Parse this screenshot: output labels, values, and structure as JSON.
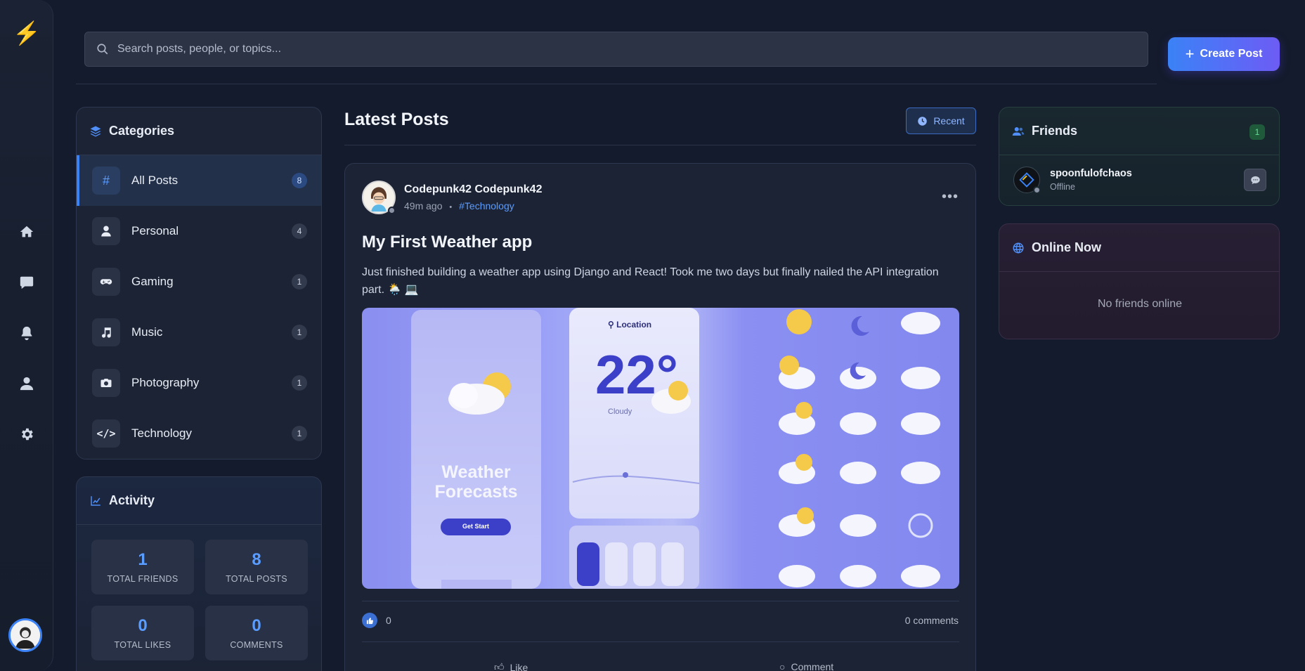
{
  "app": {
    "logo_icon": "lightning-bolt-icon"
  },
  "rail": {
    "items": [
      {
        "icon": "home-icon"
      },
      {
        "icon": "chat-icon"
      },
      {
        "icon": "bell-icon"
      },
      {
        "icon": "user-icon"
      },
      {
        "icon": "gear-icon"
      }
    ]
  },
  "search": {
    "placeholder": "Search posts, people, or topics..."
  },
  "header": {
    "create_label": "Create Post"
  },
  "categories": {
    "title": "Categories",
    "items": [
      {
        "label": "All Posts",
        "count": "8",
        "icon": "hash-icon",
        "active": true
      },
      {
        "label": "Personal",
        "count": "4",
        "icon": "person-icon"
      },
      {
        "label": "Gaming",
        "count": "1",
        "icon": "gamepad-icon"
      },
      {
        "label": "Music",
        "count": "1",
        "icon": "music-note-icon"
      },
      {
        "label": "Photography",
        "count": "1",
        "icon": "camera-icon"
      },
      {
        "label": "Technology",
        "count": "1",
        "icon": "code-icon"
      }
    ]
  },
  "activity": {
    "title": "Activity",
    "stats": [
      {
        "value": "1",
        "label": "TOTAL FRIENDS"
      },
      {
        "value": "8",
        "label": "TOTAL POSTS"
      },
      {
        "value": "0",
        "label": "TOTAL LIKES"
      },
      {
        "value": "0",
        "label": "COMMENTS"
      }
    ]
  },
  "feed": {
    "title": "Latest Posts",
    "sort_label": "Recent",
    "post": {
      "author": "Codepunk42 Codepunk42",
      "time": "49m ago",
      "separator": "•",
      "tag": "#Technology",
      "title": "My First Weather app",
      "body": "Just finished building a weather app using Django and React! Took me two days but finally nailed the API integration part. 🌦️ 💻",
      "image": {
        "heading_line1": "Weather",
        "heading_line2": "Forecasts",
        "button": "Get Start",
        "location": "Location",
        "temp": "22°",
        "condition": "Cloudy"
      },
      "like_count": "0",
      "comment_count": "0 comments",
      "like_label": "Like",
      "comment_label": "Comment"
    }
  },
  "friends": {
    "title": "Friends",
    "count": "1",
    "list": [
      {
        "name": "spoonfulofchaos",
        "status": "Offline"
      }
    ]
  },
  "online": {
    "title": "Online Now",
    "empty": "No friends online"
  },
  "colors": {
    "accent": "#3b82f6",
    "bg": "#141b2c",
    "card": "#1b2334"
  }
}
